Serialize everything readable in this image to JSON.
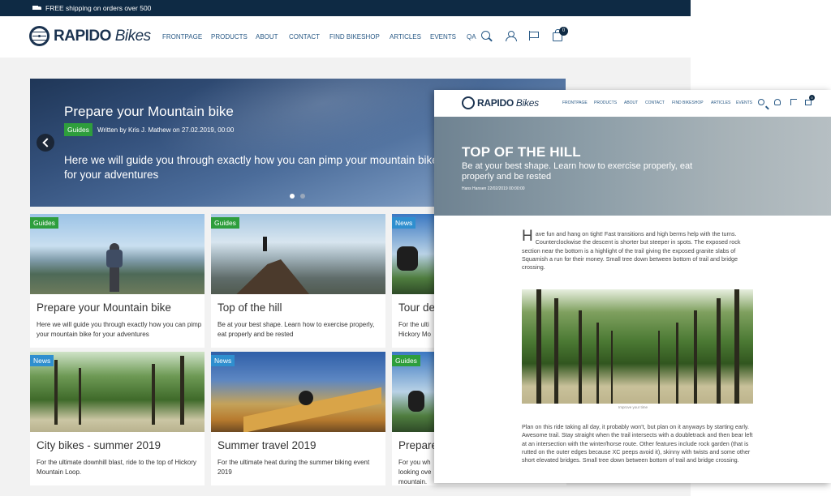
{
  "topbar": {
    "shipping_text": "FREE shipping on orders over 500"
  },
  "brand": {
    "name_bold": "RAPIDO",
    "name_italic": "Bikes"
  },
  "nav": {
    "items": [
      "FRONTPAGE",
      "PRODUCTS",
      "ABOUT",
      "CONTACT",
      "FIND BIKESHOP",
      "ARTICLES",
      "EVENTS",
      "QA"
    ],
    "cart_count": "0"
  },
  "hero": {
    "title": "Prepare your Mountain bike",
    "tag": "Guides",
    "byline": "Written by Kris J. Mathew on 27.02.2019, 00:00",
    "text": "Here we will guide you through exactly how you can pimp your mountain bike for your adventures",
    "slides": 2,
    "active_slide": 1
  },
  "cards": [
    {
      "tag": "Guides",
      "title": "Prepare your Mountain bike",
      "desc": "Here we will guide you through exactly how you can pimp your mountain bike for your adventures"
    },
    {
      "tag": "Guides",
      "title": "Top of the hill",
      "desc": "Be at your best shape. Learn how to exercise properly, eat properly and be rested"
    },
    {
      "tag": "News",
      "title": "Tour de",
      "desc": "For the ulti Hickory Mo"
    },
    {
      "tag": "News",
      "title": "City bikes - summer 2019",
      "desc": "For the ultimate downhill blast, ride to the top of Hickory Mountain Loop."
    },
    {
      "tag": "News",
      "title": "Summer travel 2019",
      "desc": "For the ultimate heat during the summer biking event 2019"
    },
    {
      "tag": "Guides",
      "title": "Prepare",
      "desc": "For you wh looking ove mountain."
    }
  ],
  "article": {
    "nav_items": [
      "FRONTPAGE",
      "PRODUCTS",
      "ABOUT",
      "CONTACT",
      "FIND BIKESHOP",
      "ARTICLES",
      "EVENTS"
    ],
    "cart_count": "0",
    "title": "TOP OF THE HILL",
    "subtitle": "Be at your best shape. Learn how to exercise properly, eat properly and be rested",
    "byline": "Hans Hansen 22/02/2019 00:00:00",
    "dropcap": "H",
    "body1": "ave fun and hang on tight! Fast transitions and high berms help with the turns. Counterclockwise the descent is shorter but steeper in spots. The exposed rock section near the bottom is a highlight of the trail giving the exposed granite slabs of Squamish a run for their money. Small tree down between bottom of trail and bridge crossing.",
    "caption": "Improve your time",
    "body2": "Plan on this ride taking all day, it probably won't, but plan on it anyways by starting early. Awesome trail. Stay straight when the trail intersects with a doubletrack and then bear left at an intersection with the winter/horse route. Other features include rock garden (that is rutted on the outer edges because XC peeps avoid it), skinny with twists and some other short elevated bridges. Small tree down between bottom of trail and bridge crossing."
  }
}
